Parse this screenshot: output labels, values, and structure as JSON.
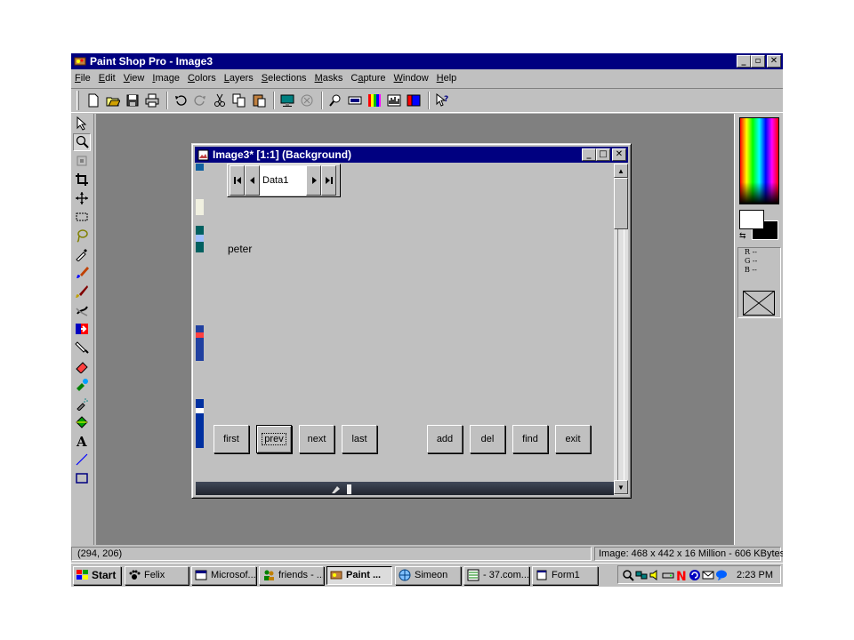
{
  "window": {
    "title": "Paint Shop Pro - Image3",
    "buttons": {
      "minimize": "_",
      "maximize": "▫",
      "close": "✕"
    }
  },
  "menu": [
    {
      "label": "File",
      "mnemonic": "F",
      "rest": "ile"
    },
    {
      "label": "Edit",
      "mnemonic": "E",
      "rest": "dit"
    },
    {
      "label": "View",
      "mnemonic": "V",
      "rest": "iew"
    },
    {
      "label": "Image",
      "mnemonic": "I",
      "rest": "mage"
    },
    {
      "label": "Colors",
      "mnemonic": "C",
      "rest": "olors"
    },
    {
      "label": "Layers",
      "mnemonic": "L",
      "rest": "ayers"
    },
    {
      "label": "Selections",
      "mnemonic": "S",
      "rest": "elections"
    },
    {
      "label": "Masks",
      "mnemonic": "M",
      "rest": "asks"
    },
    {
      "label": "Capture",
      "mnemonic": "a",
      "rest_before": "C",
      "rest": "pture"
    },
    {
      "label": "Window",
      "mnemonic": "W",
      "rest": "indow"
    },
    {
      "label": "Help",
      "mnemonic": "H",
      "rest": "elp"
    }
  ],
  "toolbar_icons": [
    "new-icon",
    "open-icon",
    "save-icon",
    "print-icon",
    "undo-icon",
    "redo-icon",
    "cut-icon",
    "copy-icon",
    "paste-icon",
    "full-screen-icon",
    "browse-icon",
    "zoom-icon",
    "toggle-toolbar-icon",
    "color-palette-icon",
    "histogram-icon",
    "layers-icon",
    "context-help-icon"
  ],
  "tool_icons": [
    "arrow-icon",
    "zoom-tool-icon",
    "deformation-icon",
    "crop-icon",
    "mover-icon",
    "selection-icon",
    "lasso-icon",
    "dropper-icon",
    "paintbrush-icon",
    "clone-icon",
    "color-replacer-icon",
    "retouch-icon",
    "scratch-remover-icon",
    "eraser-icon",
    "picture-tube-icon",
    "airbrush-icon",
    "flood-fill-icon",
    "text-icon",
    "line-icon",
    "shape-icon"
  ],
  "color_panel": {
    "r": "R --",
    "g": "G --",
    "b": "B --"
  },
  "document": {
    "title": "Image3* [1:1] (Background)",
    "navigator_caption": "Data1",
    "field_text": "peter",
    "buttons": {
      "first": "first",
      "prev": "prev",
      "next": "next",
      "last": "last",
      "add": "add",
      "del": "del",
      "find": "find",
      "exit": "exit"
    }
  },
  "status": {
    "coords": "(294, 206)",
    "image_info": "Image:  468 x 442 x 16 Million - 606 KBytes"
  },
  "taskbar": {
    "start": "Start",
    "tasks": [
      {
        "label": "Felix",
        "active": false
      },
      {
        "label": "Microsof...",
        "active": false
      },
      {
        "label": "friends - ...",
        "active": false
      },
      {
        "label": "Paint ...",
        "active": true
      },
      {
        "label": "Simeon",
        "active": false
      },
      {
        "label": "- 37.com...",
        "active": false
      },
      {
        "label": "Form1",
        "active": false
      }
    ],
    "clock": "2:23 PM"
  }
}
